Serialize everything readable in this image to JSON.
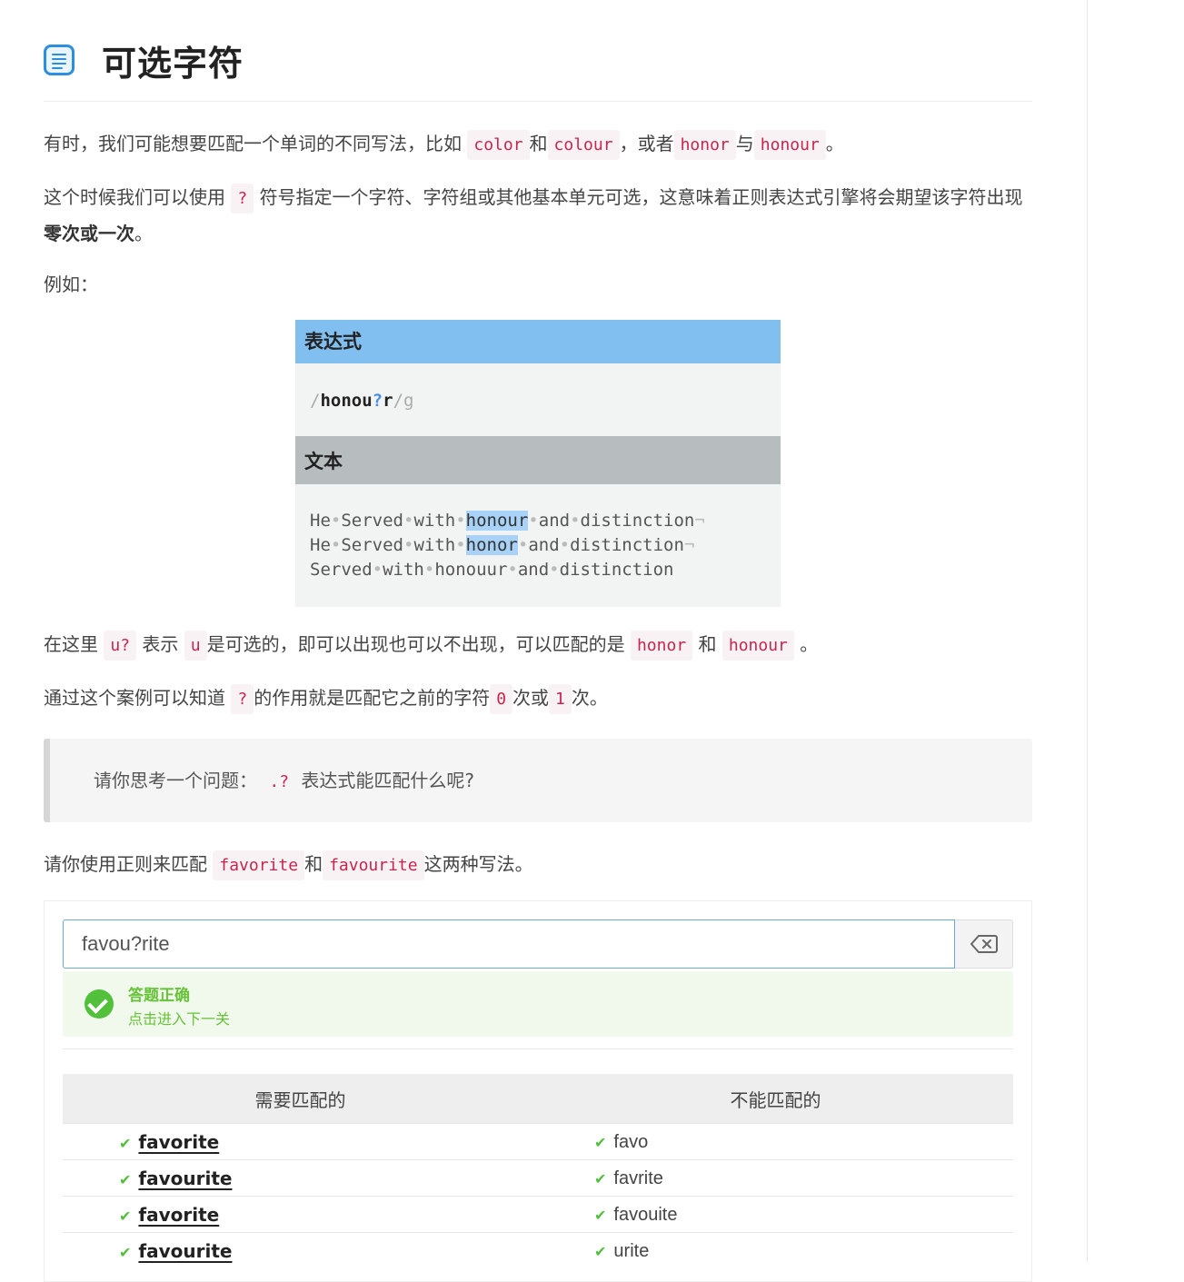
{
  "title": "可选字符",
  "intro": {
    "text_before": "有时，我们可能想要匹配一个单词的不同写法，比如",
    "code_color": "color",
    "and": "和",
    "code_colour": "colour",
    "or": "，或者",
    "code_honor": "honor",
    "with": "与",
    "code_honour": "honour",
    "end": "。"
  },
  "para2": {
    "before": "这个时候我们可以使用",
    "code_q": "?",
    "after": "符号指定一个字符、字符组或其他基本单元可选，这意味着正则表达式引擎将会期望该字符出现",
    "bold": "零次或一次",
    "end": "。"
  },
  "example_label": "例如：",
  "figure": {
    "expression_header": "表达式",
    "expression": {
      "slash": "/",
      "pre": "honou",
      "q": "?",
      "post": "r",
      "flag": "/g"
    },
    "text_header": "文本",
    "lines": [
      [
        "He",
        "Served",
        "with",
        "honour",
        "and",
        "distinction"
      ],
      [
        "He",
        "Served",
        "with",
        "honor",
        "and",
        "distinction"
      ],
      [
        "Served",
        "with",
        "honouur",
        "and",
        "distinction"
      ]
    ]
  },
  "para3": {
    "before": "在这里",
    "code_uq": "u?",
    "mid1": "表示",
    "code_u": "u",
    "mid2": "是可选的，即可以出现也可以不出现，可以匹配的是",
    "code_honor": "honor",
    "and": "和",
    "code_honour": "honour",
    "end": "。"
  },
  "para4": {
    "before": "通过这个案例可以知道",
    "code_q": "?",
    "mid": "的作用就是匹配它之前的字符",
    "code_0": "0",
    "or": "次或",
    "code_1": "1",
    "end": "次。"
  },
  "quote": {
    "before": "请你思考一个问题：",
    "code": ".?",
    "after": "表达式能匹配什么呢?"
  },
  "task_prompt": {
    "before": "请你使用正则来匹配",
    "code_a": "favorite",
    "and": "和",
    "code_b": "favourite",
    "after": "这两种写法。"
  },
  "answer": {
    "value": "favou?rite"
  },
  "result": {
    "title": "答题正确",
    "next": "点击进入下一关"
  },
  "table": {
    "col_match": "需要匹配的",
    "col_nomatch": "不能匹配的",
    "rows": [
      {
        "match": "favorite",
        "nomatch": "favo"
      },
      {
        "match": "favourite",
        "nomatch": "favrite"
      },
      {
        "match": "favorite",
        "nomatch": "favouite"
      },
      {
        "match": "favourite",
        "nomatch": "urite"
      }
    ]
  },
  "icons": {
    "title": "document-icon",
    "clear": "backspace-icon",
    "success": "check-circle-icon",
    "row": "check-icon"
  },
  "colors": {
    "code_text": "#c7254e",
    "code_bg": "#f9f2f4",
    "success": "#67c23a",
    "highlight": "#a8d2f7",
    "expr_header": "#80bff0"
  }
}
